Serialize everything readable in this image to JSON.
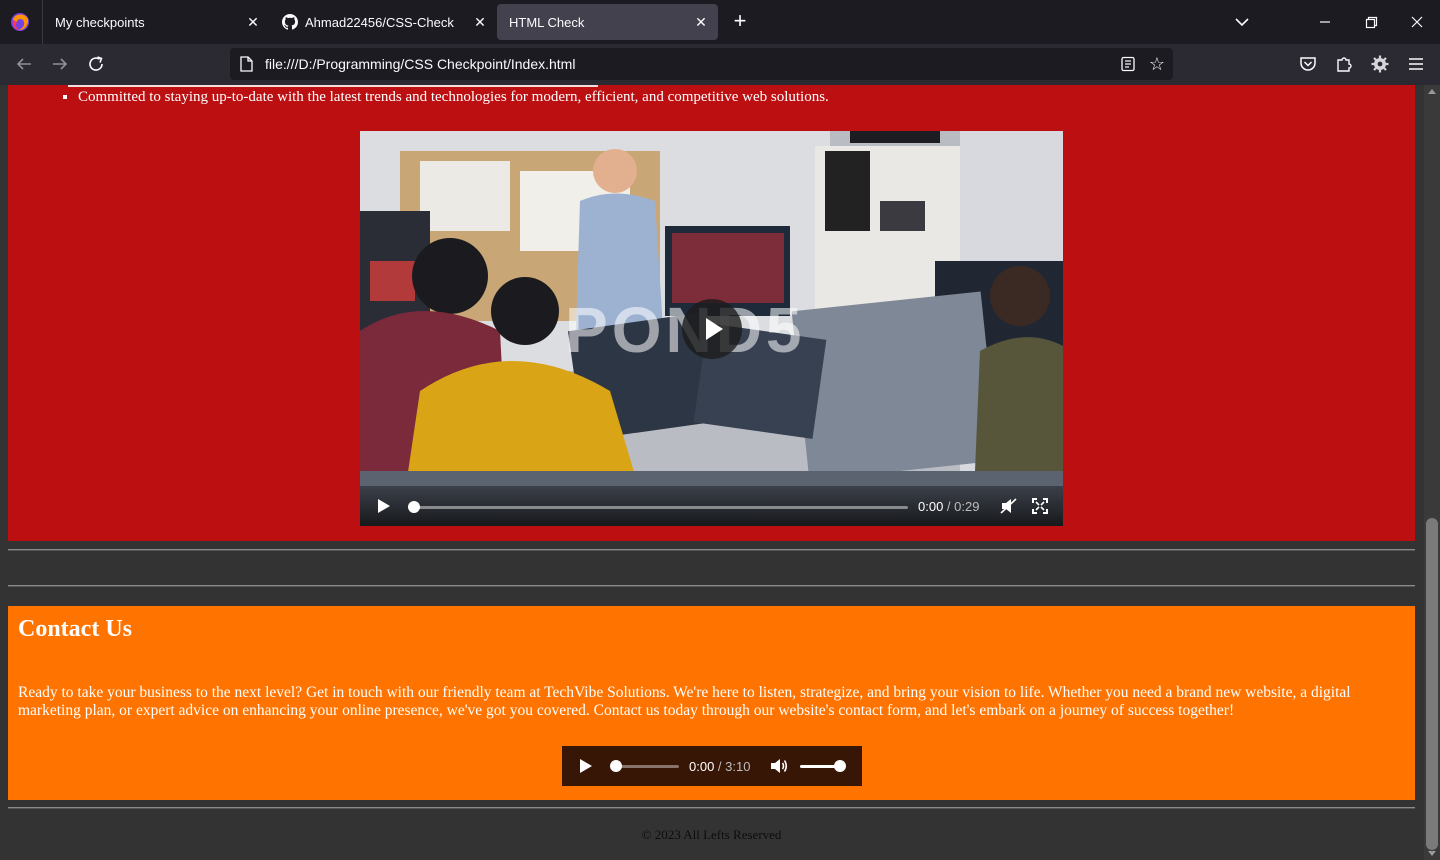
{
  "browser": {
    "tabs": [
      {
        "label": "My checkpoints",
        "active": false
      },
      {
        "label": "Ahmad22456/CSS-Check",
        "active": false
      },
      {
        "label": "HTML Check",
        "active": true
      }
    ],
    "url": "file:///D:/Programming/CSS Checkpoint/Index.html",
    "window_controls": [
      "minimize-icon",
      "restore-icon",
      "close-icon"
    ]
  },
  "about": {
    "list_items": [
      "Committed to staying up-to-date with the latest trends and technologies for modern, efficient, and competitive web solutions."
    ]
  },
  "video": {
    "watermark": "POND5",
    "current_time": "0:00",
    "separator": " / ",
    "duration": "0:29",
    "progress": 0
  },
  "contact": {
    "title": "Contact Us",
    "body": "Ready to take your business to the next level? Get in touch with our friendly team at TechVibe Solutions. We're here to listen, strategize, and bring your vision to life. Whether you need a brand new website, a digital marketing plan, or expert advice on enhancing your online presence, we've got you covered. Contact us today through our website's contact form, and let's embark on a journey of success together!",
    "audio": {
      "current_time": "0:00",
      "separator": " / ",
      "duration": "3:10",
      "progress": 0,
      "volume": 1
    }
  },
  "footer": {
    "text": "© 2023 All Lefts Reserved"
  },
  "colors": {
    "about_bg": "#bb0f11",
    "contact_bg": "#ff7300",
    "page_bg": "#333333",
    "chrome_bg": "#1c1b22",
    "toolbar_bg": "#2b2a33"
  }
}
